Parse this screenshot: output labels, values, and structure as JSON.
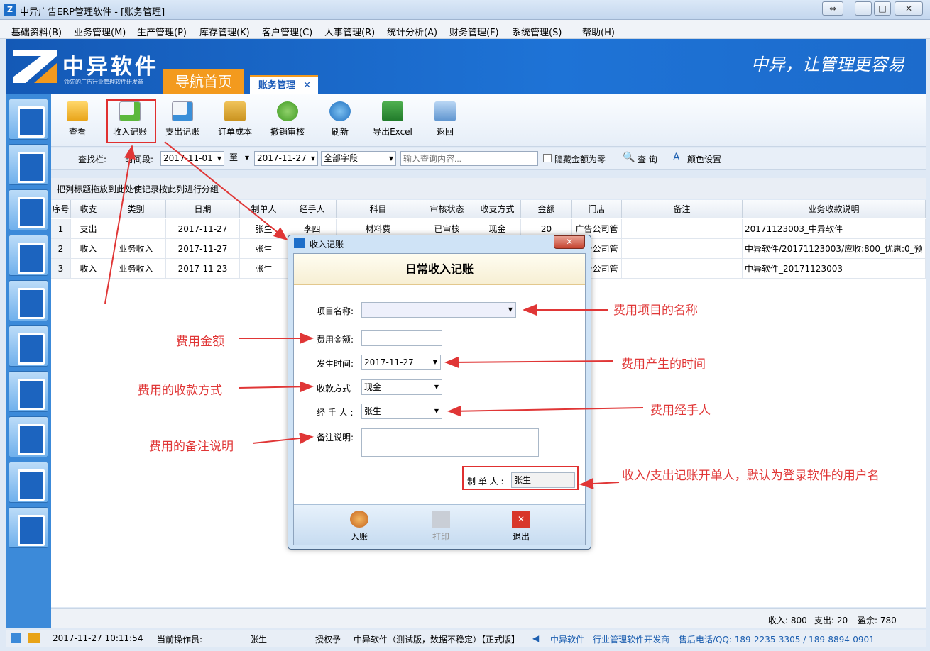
{
  "window": {
    "title": "中异广告ERP管理软件 - [账务管理]",
    "logo_letter": "Z",
    "btn_restore": "⇔",
    "btn_min": "—",
    "btn_max": "□",
    "btn_close": "✕"
  },
  "menu": [
    "基础资料(B)",
    "业务管理(M)",
    "生产管理(P)",
    "库存管理(K)",
    "客户管理(C)",
    "人事管理(R)",
    "统计分析(A)",
    "财务管理(F)",
    "系统管理(S)",
    "帮助(H)"
  ],
  "header": {
    "brand": "中异软件",
    "brand_sub": "领先的广告行业管理软件研发商",
    "nav_home": "导航首页",
    "nav_tab": "账务管理",
    "nav_tab_close": "✕",
    "slogan": "中异，让管理更容易"
  },
  "toolbar": {
    "view": "查看",
    "income": "收入记账",
    "expense": "支出记账",
    "order_cost": "订单成本",
    "undo_audit": "撤销审核",
    "refresh": "刷新",
    "export": "导出Excel",
    "back": "返回"
  },
  "search": {
    "label": "查找栏:",
    "period_label": "时间段:",
    "date_from": "2017-11-01",
    "to_label": "至",
    "date_to": "2017-11-27",
    "field": "全部字段",
    "placeholder": "输入查询内容...",
    "hide_zero": "隐藏金额为零",
    "query": "查 询",
    "color_settings": "颜色设置"
  },
  "group_hint": "把列标题拖放到此处使记录按此列进行分组",
  "grid": {
    "columns": [
      "序号",
      "收支",
      "类别",
      "日期",
      "制单人",
      "经手人",
      "科目",
      "审核状态",
      "收支方式",
      "金额",
      "门店",
      "备注",
      "业务收款说明"
    ],
    "rows": [
      [
        "1",
        "支出",
        "",
        "2017-11-27",
        "张生",
        "李四",
        "材料费",
        "已审核",
        "现金",
        "20",
        "广告公司管",
        "",
        "20171123003_中异软件"
      ],
      [
        "2",
        "收入",
        "业务收入",
        "2017-11-27",
        "张生",
        "",
        "",
        "",
        "",
        "",
        "广告公司管",
        "",
        "中异软件/20171123003/应收:800_优惠:0_预"
      ],
      [
        "3",
        "收入",
        "业务收入",
        "2017-11-23",
        "张生",
        "",
        "",
        "",
        "",
        "",
        "广告公司管",
        "",
        "中异软件_20171123003"
      ]
    ]
  },
  "summary": {
    "income": "收入: 800",
    "expense": "支出: 20",
    "profit": "盈余: 780"
  },
  "status": {
    "datetime": "2017-11-27 10:11:54",
    "operator_label": "当前操作员:",
    "operator": "张生",
    "license_label": "授权予",
    "license": "中异软件（测试版，数据不稳定）【正式版】",
    "company": "中异软件 - 行业管理软件开发商",
    "hotline": "售后电话/QQ: 189-2235-3305 / 189-8894-0901"
  },
  "dialog": {
    "title": "收入记账",
    "header": "日常收入记账",
    "item_label": "项目名称:",
    "amount_label": "费用金额:",
    "time_label": "发生时间:",
    "time_value": "2017-11-27",
    "method_label": "收款方式",
    "method_value": "现金",
    "handler_label": "经 手 人 :",
    "handler_value": "张生",
    "note_label": "备注说明:",
    "creator_label": "制 单 人 :",
    "creator_value": "张生",
    "btn_post": "入账",
    "btn_print": "打印",
    "btn_exit": "退出"
  },
  "annotations": {
    "item": "费用项目的名称",
    "amount": "费用金额",
    "time": "费用产生的时间",
    "method": "费用的收款方式",
    "handler": "费用经手人",
    "note": "费用的备注说明",
    "creator": "收入/支出记账开单人，默认为登录软件的用户名"
  },
  "colors": {
    "accent_orange": "#f39a1e",
    "brand_blue": "#1e73d6",
    "annotation_red": "#e03636"
  }
}
